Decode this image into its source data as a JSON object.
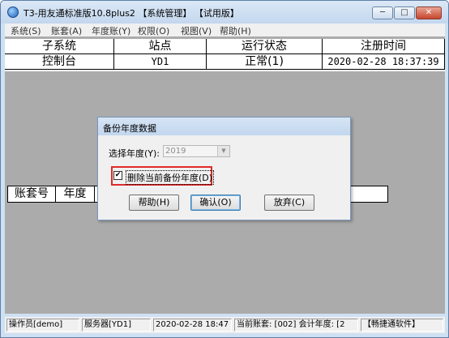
{
  "window": {
    "title": "T3-用友通标准版10.8plus2 【系统管理】 【试用版】",
    "min_label": "─",
    "max_label": "□",
    "close_label": "✕"
  },
  "menu": {
    "items": [
      "系统(S)",
      "账套(A)",
      "年度账(Y)",
      "权限(O)",
      "视图(V)",
      "帮助(H)"
    ]
  },
  "grid": {
    "headers": [
      "子系统",
      "站点",
      "运行状态",
      "注册时间"
    ],
    "row": [
      "控制台",
      "YD1",
      "正常(1)",
      "2020-02-28 18:37:39"
    ]
  },
  "grid2": {
    "headers": [
      "账套号",
      "年度"
    ]
  },
  "dialog": {
    "title": "备份年度数据",
    "year_label": "选择年度(Y):",
    "year_value": "2019",
    "checkbox_label": "删除当前备份年度(D)",
    "checkbox_mark": "✔",
    "checkbox_checked": true,
    "buttons": {
      "help": "帮助(H)",
      "ok": "确认(O)",
      "cancel": "放弃(C)"
    },
    "highlight_color": "#e02a2a"
  },
  "statusbar": {
    "operator": "操作员[demo]",
    "server": "服务器[YD1]",
    "datetime": "2020-02-28 18:47",
    "current_account": "当前账套: [002] 会计年度: [2",
    "brand": "【畅捷通软件】"
  }
}
